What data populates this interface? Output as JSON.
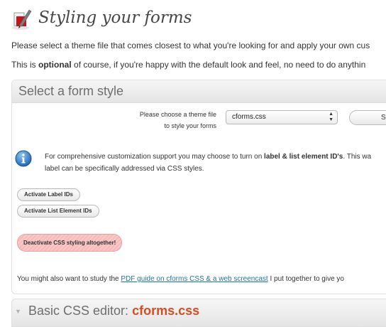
{
  "header": {
    "title": "Styling your forms"
  },
  "intro": {
    "line1": "Please select a theme file that comes closest to what you're looking for and apply your own cus",
    "line2_pre": "This is ",
    "line2_bold": "optional",
    "line2_post": " of course, if you're happy with the default look and feel, no need to do anythin"
  },
  "select_form_style": {
    "title": "Select a form style",
    "theme_label_line1": "Please choose a theme file",
    "theme_label_line2": "to style your forms",
    "theme_selected": "cforms.css",
    "save_button_label": "Se",
    "info_pre": "For comprehensive customization support you may choose to turn on ",
    "info_bold": "label & list element ID's",
    "info_post": ". This wa",
    "info_line2": "label can be specifically addressed via CSS styles.",
    "activate_label_ids": "Activate Label IDs",
    "activate_list_ids": "Activate List Element IDs",
    "deactivate_css": "Deactivate CSS styling altogether!",
    "study_pre": "You might also want to study the ",
    "study_link": "PDF guide on cforms CSS & a web screencast",
    "study_post": " I put together to give yo"
  },
  "basic_css_editor": {
    "title_prefix": "Basic CSS editor: ",
    "title_file": "cforms.css"
  },
  "colors": {
    "link": "#21759b",
    "accent_orange": "#d54e21",
    "deactivate_bg": "#f9c9c9"
  },
  "icons": {
    "header": "page-styling-icon",
    "info": "info-icon",
    "select": "select-arrows-icon",
    "toggle": "toggle-arrow-icon"
  }
}
